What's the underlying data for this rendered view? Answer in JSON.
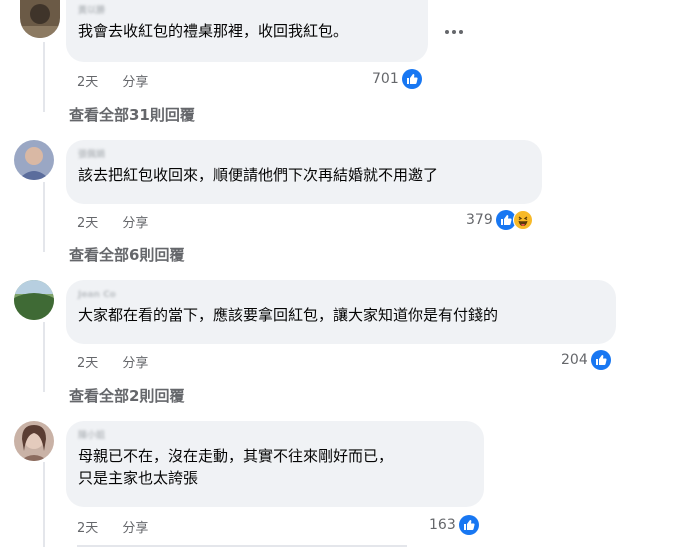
{
  "comments": [
    {
      "author": "黃以勝",
      "text_lines": [
        "我會去收紅包的禮桌那裡，收回我紅包。"
      ],
      "time": "2天",
      "share": "分享",
      "reaction_count": "701",
      "reactions": [
        "like-icon"
      ],
      "view_replies": "查看全部31則回覆"
    },
    {
      "author": "張佩娟",
      "text_lines": [
        "該去把紅包收回來，順便請他們下次再結婚就不用邀了"
      ],
      "time": "2天",
      "share": "分享",
      "reaction_count": "379",
      "reactions": [
        "like-icon",
        "haha-icon"
      ],
      "view_replies": "查看全部6則回覆"
    },
    {
      "author": "Jean Co",
      "text_lines": [
        "大家都在看的當下，應該要拿回紅包，讓大家知道你是有付錢的"
      ],
      "time": "2天",
      "share": "分享",
      "reaction_count": "204",
      "reactions": [
        "like-icon"
      ],
      "view_replies": "查看全部2則回覆"
    },
    {
      "author": "陳小姐",
      "text_lines": [
        "母親已不在，沒在走動，其實不往來剛好而已，",
        "只是主家也太誇張"
      ],
      "time": "2天",
      "share": "分享",
      "reaction_count": "163",
      "reactions": [
        "like-icon"
      ]
    }
  ],
  "colors": {
    "bubble": "#f0f2f5",
    "meta_text": "#65676b",
    "like_blue": "#1877f2",
    "haha_yellow": "#f7b928"
  }
}
